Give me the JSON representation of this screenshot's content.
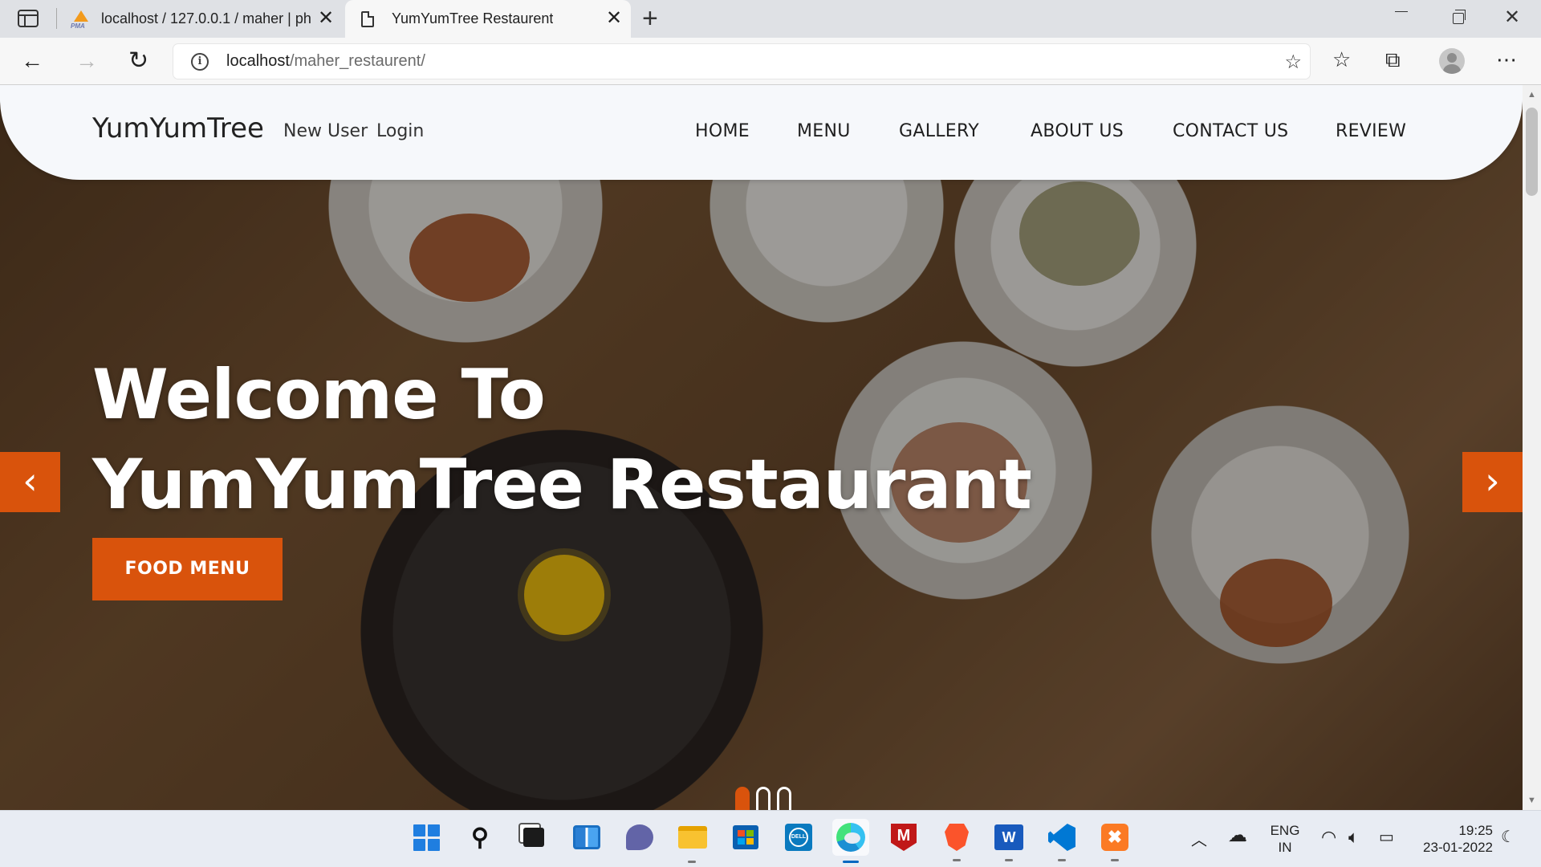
{
  "browser": {
    "tabs": [
      {
        "title": "localhost / 127.0.0.1 / maher | ph",
        "icon": "phpmyadmin-icon",
        "active": false
      },
      {
        "title": "YumYumTree Restaurent",
        "icon": "page-icon",
        "active": true
      }
    ],
    "pma_badge": "PMA",
    "url_host": "localhost",
    "url_path": "/maher_restaurent/"
  },
  "site": {
    "brand": "YumYumTree",
    "aux_links": [
      "New User",
      "Login"
    ],
    "menu": [
      "HOME",
      "MENU",
      "GALLERY",
      "ABOUT US",
      "CONTACT US",
      "REVIEW"
    ]
  },
  "hero": {
    "title_line1": "Welcome To",
    "title_line2": "YumYumTree Restaurant",
    "button_label": "FOOD MENU",
    "prev_label": "‹",
    "next_label": "›",
    "slide_count": 3,
    "active_slide": 1
  },
  "taskbar": {
    "apps": [
      "start",
      "search",
      "task-view",
      "widgets",
      "teams-chat",
      "file-explorer",
      "microsoft-store",
      "dell",
      "edge",
      "mcafee",
      "brave",
      "word",
      "vscode",
      "xampp"
    ],
    "lang_line1": "ENG",
    "lang_line2": "IN",
    "time": "19:25",
    "date": "23-01-2022"
  },
  "colors": {
    "accent": "#d9530c",
    "nav_bg": "#f6f8fb",
    "tab_strip": "#dfe1e5"
  }
}
